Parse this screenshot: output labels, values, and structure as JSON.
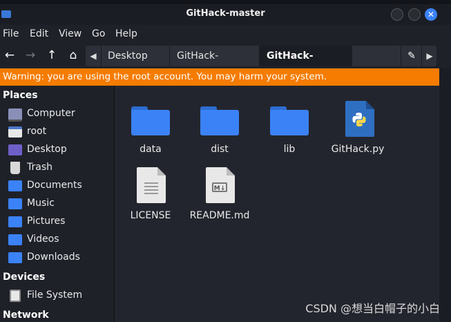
{
  "window": {
    "title": "GitHack-master"
  },
  "menu": [
    "File",
    "Edit",
    "View",
    "Go",
    "Help"
  ],
  "nav": {
    "back": "←",
    "forward": "→",
    "up": "↑",
    "home": "⌂"
  },
  "breadcrumbs": [
    "Desktop",
    "GitHack-master",
    "GitHack-master"
  ],
  "warning": "Warning: you are using the root account. You may harm your system.",
  "sidebar": {
    "places_title": "Places",
    "places": [
      {
        "label": "Computer",
        "icon": "monitor-icon"
      },
      {
        "label": "root",
        "icon": "home-folder-icon"
      },
      {
        "label": "Desktop",
        "icon": "desktop-folder-icon"
      },
      {
        "label": "Trash",
        "icon": "trash-icon"
      },
      {
        "label": "Documents",
        "icon": "documents-folder-icon"
      },
      {
        "label": "Music",
        "icon": "music-folder-icon"
      },
      {
        "label": "Pictures",
        "icon": "pictures-folder-icon"
      },
      {
        "label": "Videos",
        "icon": "videos-folder-icon"
      },
      {
        "label": "Downloads",
        "icon": "downloads-folder-icon"
      }
    ],
    "devices_title": "Devices",
    "devices": [
      {
        "label": "File System",
        "icon": "drive-icon"
      }
    ],
    "network_title": "Network"
  },
  "files": [
    {
      "name": "data",
      "type": "folder"
    },
    {
      "name": "dist",
      "type": "folder"
    },
    {
      "name": "lib",
      "type": "folder"
    },
    {
      "name": "GitHack.py",
      "type": "python"
    },
    {
      "name": "LICENSE",
      "type": "text"
    },
    {
      "name": "README.md",
      "type": "markdown"
    }
  ],
  "watermark": "CSDN @想当白帽子的小白",
  "colors": {
    "warning": "#f57c00",
    "accent": "#3b82f6"
  }
}
